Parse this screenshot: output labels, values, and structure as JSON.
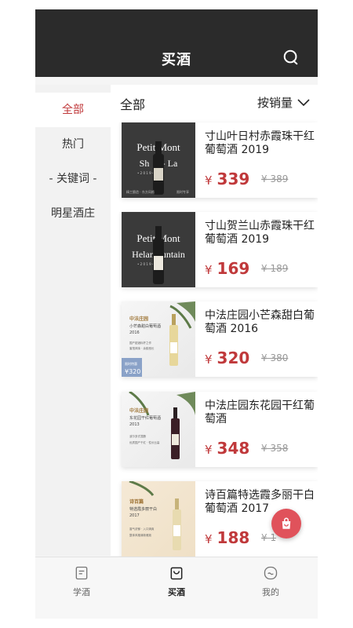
{
  "header": {
    "title": "买酒"
  },
  "sidebar": {
    "items": [
      {
        "label": "全部",
        "active": true
      },
      {
        "label": "热门",
        "active": false
      },
      {
        "label": "- 关键词 -",
        "active": false
      },
      {
        "label": "明星酒庄",
        "active": false
      }
    ]
  },
  "main": {
    "section_label": "全部",
    "sort_label": "按销量"
  },
  "products": [
    {
      "name": "寸山叶日村赤霞珠干红葡萄酒  2019",
      "price": "339",
      "old_price": "¥ 389",
      "currency": "¥",
      "thumb_text": "Petit Mont",
      "thumb_sub": "Sh  ri - La",
      "thumb_year": "• 2 0 1 9 •",
      "thumb_foot_left": "精工酿造 · 东方风格",
      "thumb_foot_right": "限时专享"
    },
    {
      "name": "寸山贺兰山赤霞珠干红葡萄酒    2019",
      "price": "169",
      "old_price": "¥ 189",
      "currency": "¥",
      "thumb_text": "Petit Mont",
      "thumb_sub": "Helan   untain",
      "thumb_year": "• 2 0 1 9 •"
    },
    {
      "name": "中法庄园小芒森甜白葡萄酒 2016",
      "price": "320",
      "old_price": "¥ 380",
      "currency": "¥",
      "thumb_title": "中法庄园",
      "thumb_line1": "小芒森甜白葡萄酒",
      "thumb_line2": "2016",
      "thumb_bullet1": "国产甜酒标杆之作",
      "thumb_bullet2": "蜜饯风味 · 余韵悠长",
      "thumb_badge": "限时特惠",
      "thumb_price": "¥320"
    },
    {
      "name": "中法庄园东花园干红葡萄酒",
      "price": "348",
      "old_price": "¥ 358",
      "currency": "¥",
      "thumb_title": "中法庄园",
      "thumb_line1": "东花园干红葡萄酒",
      "thumb_line2": "2013",
      "thumb_bullet1": "波尔多式混酿",
      "thumb_bullet2": "优质国产干红 · 性价比高"
    },
    {
      "name": "诗百篇特选霞多丽干白葡萄酒 2017",
      "price": "188",
      "old_price": "¥ 1",
      "currency": "¥",
      "thumb_title": "诗百篇",
      "thumb_line1": "特选霞多丽干白",
      "thumb_line2": "2017",
      "thumb_bullet1": "香气浓郁 · 入口清爽",
      "thumb_bullet2": "整体风格清新雅致"
    }
  ],
  "tabs": [
    {
      "label": "学酒",
      "icon": "book-icon",
      "active": false
    },
    {
      "label": "买酒",
      "icon": "bag-icon",
      "active": true
    },
    {
      "label": "我的",
      "icon": "smile-icon",
      "active": false
    }
  ],
  "colors": {
    "accent": "#c0393b",
    "header_bg": "#2b2b2b",
    "fab": "#e0525b"
  }
}
